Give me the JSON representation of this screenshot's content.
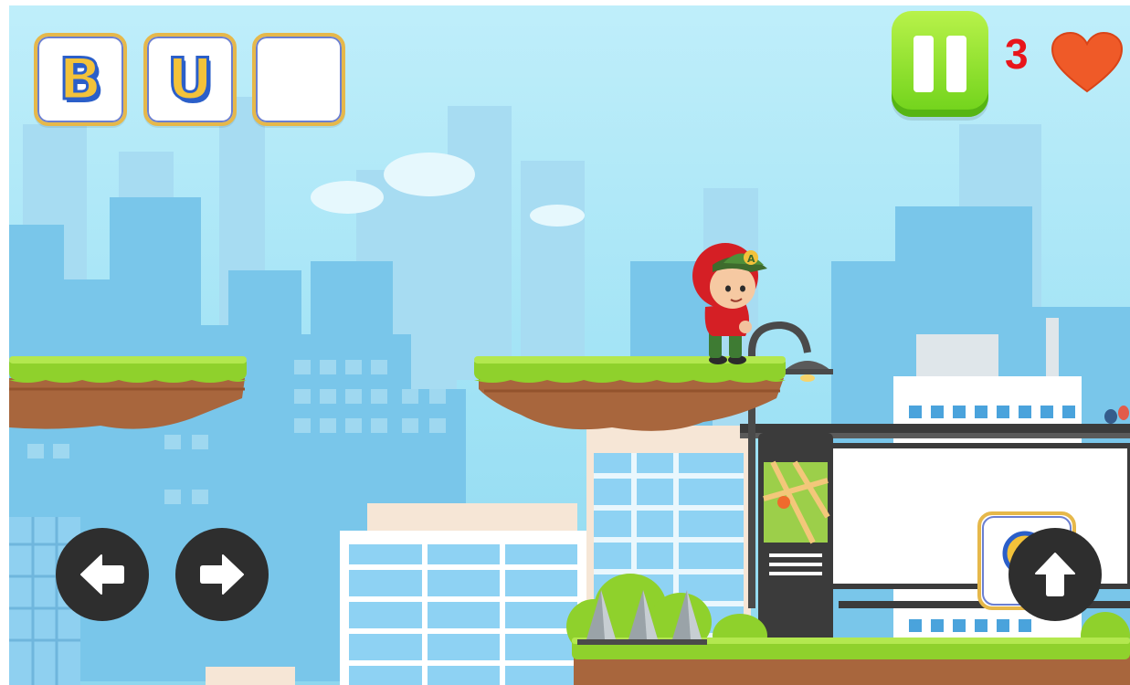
{
  "hud": {
    "letter_slots": [
      "B",
      "U",
      ""
    ],
    "lives": "3"
  },
  "icons": {
    "pause": "pause-icon",
    "heart": "heart-icon",
    "left": "arrow-left-icon",
    "right": "arrow-right-icon",
    "jump": "arrow-up-icon"
  },
  "colors": {
    "sky": "#a8e6f7",
    "building": "#79c6ea",
    "grass": "#8fd12c",
    "dirt": "#a8663d",
    "pause_button": "#7ed321",
    "lives_text": "#e8151b",
    "heart": "#ef5a28",
    "controls": "#2e2e2e"
  },
  "map_sign": {
    "letter": "A"
  }
}
